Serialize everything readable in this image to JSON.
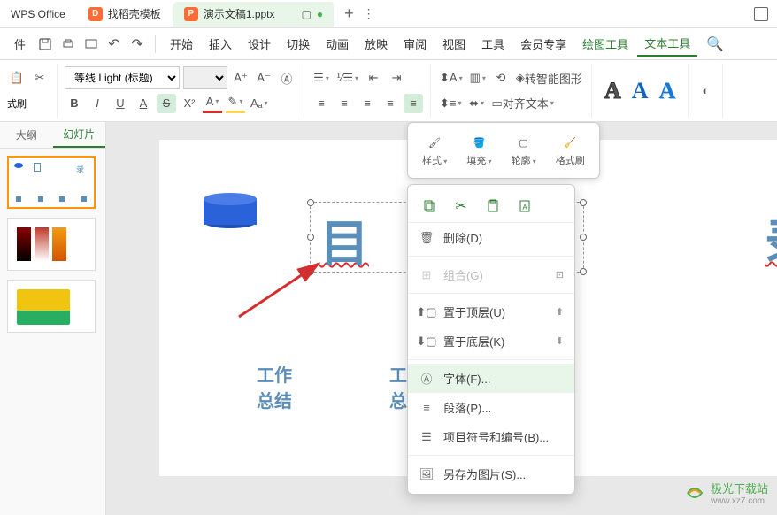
{
  "tabs": {
    "app_name": "WPS Office",
    "template_tab": "找稻壳模板",
    "file_tab": "演示文稿1.pptx",
    "file_tab_prefix": "P"
  },
  "menu": {
    "file": "件",
    "items": [
      "开始",
      "插入",
      "设计",
      "切换",
      "动画",
      "放映",
      "审阅",
      "视图",
      "工具",
      "会员专享",
      "绘图工具",
      "文本工具"
    ]
  },
  "toolbar": {
    "format_brush": "式刷",
    "font_name": "等线 Light (标题)",
    "convert_smart": "转智能图形",
    "align_text": "对齐文本"
  },
  "left_panel": {
    "outline": "大纲",
    "slides": "幻灯片"
  },
  "float_toolbar": {
    "style": "样式",
    "fill": "填充",
    "outline": "轮廓",
    "format_brush": "格式刷"
  },
  "context_menu": {
    "delete": "删除(D)",
    "group": "组合(G)",
    "bring_front": "置于顶层(U)",
    "send_back": "置于底层(K)",
    "font": "字体(F)...",
    "paragraph": "段落(P)...",
    "bullets": "项目符号和编号(B)...",
    "save_as_image": "另存为图片(S)..."
  },
  "slide_content": {
    "char_mu": "目",
    "char_lu": "录",
    "work_summary1": "工作",
    "work_summary2": "总结",
    "work_col": "工"
  },
  "watermark": {
    "name": "极光下载站",
    "url": "www.xz7.com"
  }
}
